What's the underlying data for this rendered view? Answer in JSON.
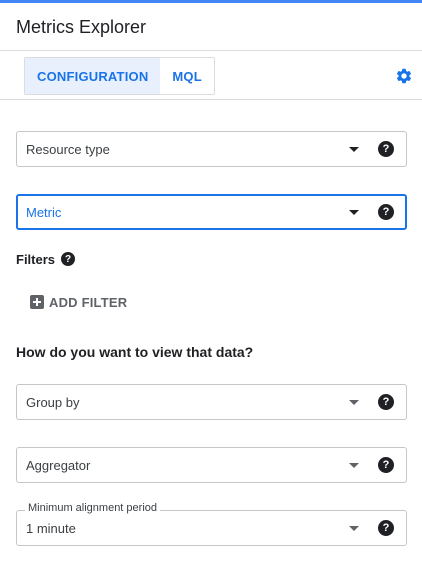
{
  "header": {
    "title": "Metrics Explorer"
  },
  "tabs": [
    {
      "label": "CONFIGURATION",
      "active": true
    },
    {
      "label": "MQL",
      "active": false
    }
  ],
  "fields": {
    "resource_type": {
      "value": "Resource type"
    },
    "metric": {
      "value": "Metric"
    },
    "group_by": {
      "value": "Group by"
    },
    "aggregator": {
      "value": "Aggregator"
    },
    "alignment": {
      "label": "Minimum alignment period",
      "value": "1 minute"
    }
  },
  "filters": {
    "label": "Filters",
    "add_label": "ADD FILTER"
  },
  "view_section": {
    "heading": "How do you want to view that data?"
  },
  "help_glyph": "?",
  "colors": {
    "accent": "#1a73e8",
    "top_bar": "#4285f4",
    "tab_active_bg": "#e8f0fe"
  },
  "icons": [
    "settings-gear-icon",
    "help-icon",
    "dropdown-arrow-icon",
    "add-box-icon"
  ]
}
